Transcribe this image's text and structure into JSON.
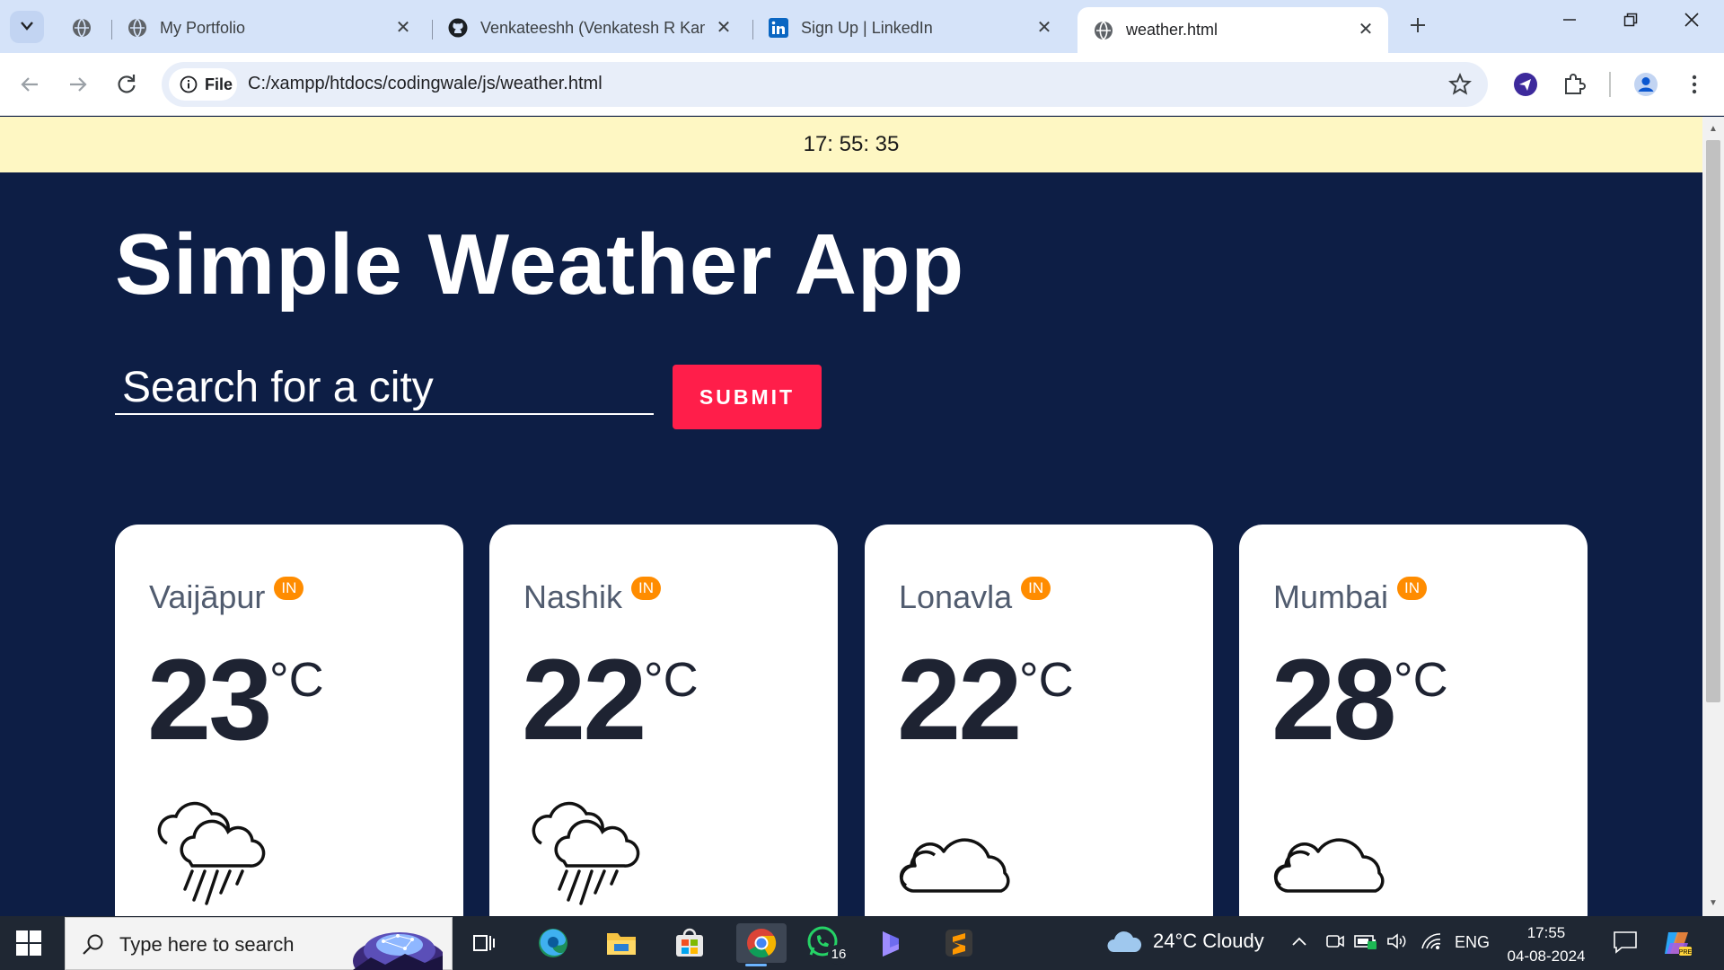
{
  "browser": {
    "tabs": [
      {
        "title": "",
        "favicon": "globe-icon"
      },
      {
        "title": "My Portfolio",
        "favicon": "globe-icon"
      },
      {
        "title": "Venkateeshh (Venkatesh R Kam",
        "favicon": "github-icon"
      },
      {
        "title": "Sign Up | LinkedIn",
        "favicon": "linkedin-icon"
      },
      {
        "title": "weather.html",
        "favicon": "globe-icon",
        "active": true
      }
    ],
    "site_chip_label": "File",
    "url": "C:/xampp/htdocs/codingwale/js/weather.html"
  },
  "page": {
    "clock_text": "17: 55: 35",
    "title": "Simple Weather App",
    "search_placeholder": "Search for a city",
    "submit_label": "SUBMIT",
    "cards": [
      {
        "city": "Vaijāpur",
        "country": "IN",
        "temp": "23",
        "unit": "°C",
        "icon": "rain-cloud-icon"
      },
      {
        "city": "Nashik",
        "country": "IN",
        "temp": "22",
        "unit": "°C",
        "icon": "rain-cloud-icon"
      },
      {
        "city": "Lonavla",
        "country": "IN",
        "temp": "22",
        "unit": "°C",
        "icon": "cloud-icon"
      },
      {
        "city": "Mumbai",
        "country": "IN",
        "temp": "28",
        "unit": "°C",
        "icon": "cloud-icon"
      }
    ]
  },
  "taskbar": {
    "search_placeholder": "Type here to search",
    "whatsapp_badge": "16",
    "weather": "24°C  Cloudy",
    "language": "ENG",
    "time": "17:55",
    "date": "04-08-2024"
  },
  "colors": {
    "page_bg": "#0d1e45",
    "clock_bar": "#fef7c3",
    "submit": "#ff1e4a",
    "badge": "#ff8c00",
    "tab_strip": "#d5e3f9"
  }
}
